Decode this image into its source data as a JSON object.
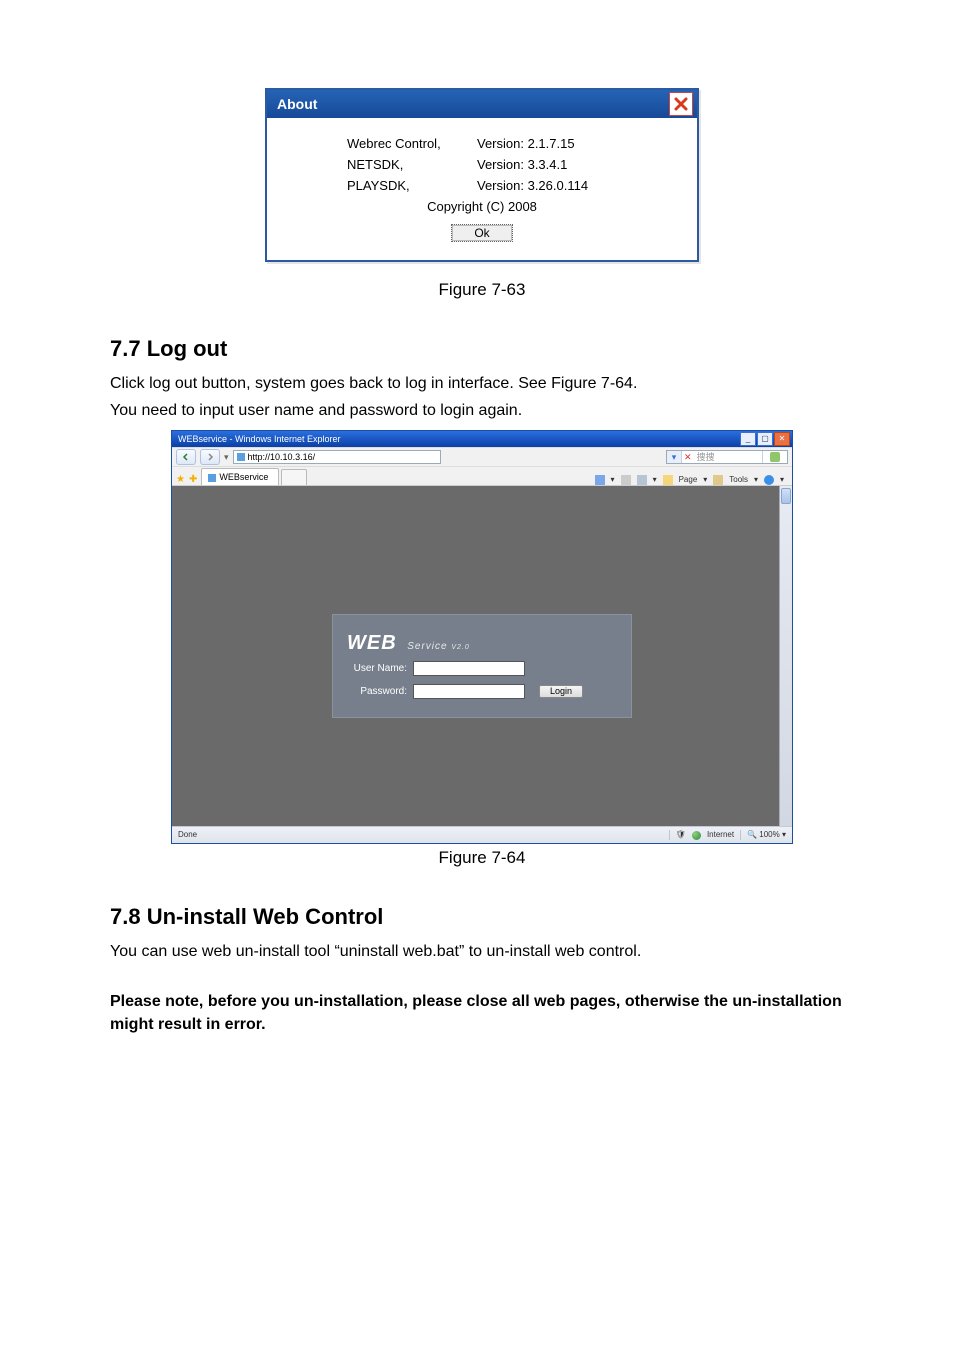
{
  "about_dialog": {
    "title": "About",
    "rows": [
      {
        "name": "Webrec Control,",
        "version": "Version: 2.1.7.15"
      },
      {
        "name": "NETSDK,",
        "version": "Version: 3.3.4.1"
      },
      {
        "name": "PLAYSDK,",
        "version": "Version: 3.26.0.114"
      }
    ],
    "copyright": "Copyright (C) 2008",
    "ok_label": "Ok"
  },
  "figure_1_caption": "Figure 7-63",
  "section_logout": {
    "heading": "7.7  Log out",
    "p1": "Click log out button, system goes back to log in interface. See Figure 7-64.",
    "p2": "You need to input user name and password to login again."
  },
  "ie_window": {
    "window_title": "WEBservice - Windows Internet Explorer",
    "address": "http://10.10.3.16/",
    "search_placeholder": "捜捜",
    "tab_label": "WEBservice",
    "toolbar": {
      "page_label": "Page",
      "tools_label": "Tools"
    },
    "login_panel": {
      "brand_main": "WEB",
      "brand_sub": "Service",
      "brand_ver": "V2.0",
      "username_label": "User Name:",
      "password_label": "Password:",
      "login_label": "Login"
    },
    "status_left": "Done",
    "status_zone": "Internet",
    "status_zoom": "100%"
  },
  "figure_2_caption": "Figure 7-64",
  "section_uninstall": {
    "heading": "7.8  Un-install Web Control",
    "p1": "You can use web un-install tool “uninstall web.bat” to un-install web control.",
    "p2_bold": "Please note, before you un-installation, please close all web pages, otherwise the un-installation might result in error."
  }
}
